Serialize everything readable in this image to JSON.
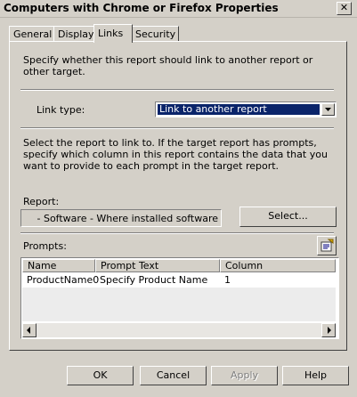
{
  "window": {
    "title": "Computers with Chrome or Firefox Properties"
  },
  "tabs": [
    {
      "label": "General"
    },
    {
      "label": "Display"
    },
    {
      "label": "Links"
    },
    {
      "label": "Security"
    }
  ],
  "active_tab": "Links",
  "links": {
    "intro": "Specify whether this report should link to another report or other target.",
    "link_type_label": "Link type:",
    "link_type_value": "Link to another report",
    "select_report_text": "Select the report to link to. If the target report has prompts, specify which column in this report contains the data that you want to provide to each prompt in the target report.",
    "report_label": "Report:",
    "report_value": "- Software - Where installed software",
    "select_button": "Select...",
    "prompts_label": "Prompts:",
    "columns": [
      "Name",
      "Prompt Text",
      "Column"
    ],
    "rows": [
      {
        "name": "ProductName0",
        "prompt_text": "Specify Product Name",
        "column": "1"
      }
    ]
  },
  "buttons": {
    "ok": "OK",
    "cancel": "Cancel",
    "apply": "Apply",
    "help": "Help"
  },
  "colors": {
    "selection": "#0a246a",
    "face": "#d4d0c8"
  }
}
